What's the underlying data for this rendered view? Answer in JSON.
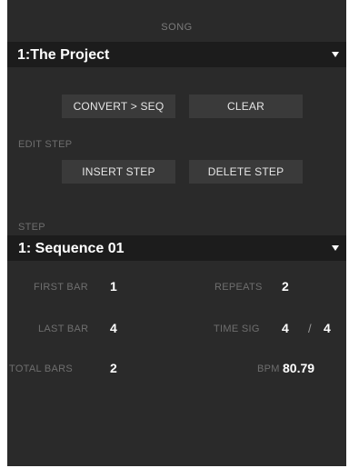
{
  "song": {
    "header": "SONG",
    "dropdown_value": "1:The Project",
    "dropdown_arrow": "chevron-down-icon"
  },
  "actions": {
    "convert_label": "CONVERT > SEQ",
    "clear_label": "CLEAR"
  },
  "edit_step": {
    "header": "EDIT STEP",
    "insert_label": "INSERT STEP",
    "delete_label": "DELETE STEP"
  },
  "step": {
    "header": "STEP",
    "dropdown_value": "1: Sequence 01",
    "dropdown_arrow": "chevron-down-icon"
  },
  "fields": {
    "first_bar_label": "FIRST BAR",
    "first_bar_value": "1",
    "repeats_label": "REPEATS",
    "repeats_value": "2",
    "last_bar_label": "LAST BAR",
    "last_bar_value": "4",
    "time_sig_label": "TIME SIG",
    "time_sig_num": "4",
    "time_sig_sep": "/",
    "time_sig_den": "4",
    "total_bars_label": "TOTAL BARS",
    "total_bars_value": "2",
    "bpm_label": "BPM",
    "bpm_value": "80.79"
  },
  "colors": {
    "panel_bg": "#2a2a2a",
    "dropdown_bg": "#1c1c1c",
    "button_bg": "#3a3a3a",
    "value_text": "#ffffff",
    "label_text": "#6f6f6f"
  }
}
